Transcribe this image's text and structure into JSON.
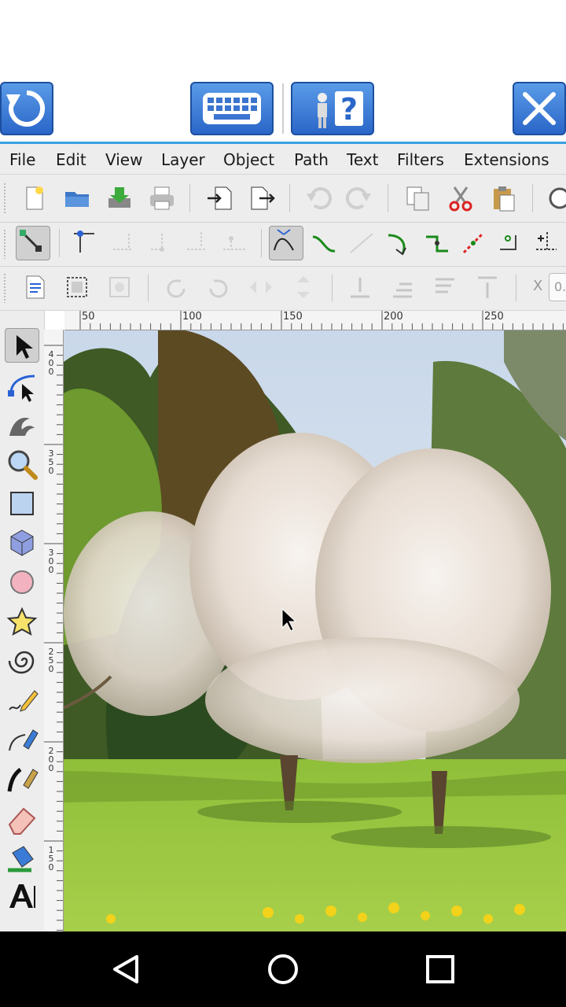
{
  "menubar": {
    "items": [
      "File",
      "Edit",
      "View",
      "Layer",
      "Object",
      "Path",
      "Text",
      "Filters",
      "Extensions"
    ]
  },
  "rulers": {
    "horizontal": [
      "50",
      "100",
      "150",
      "200",
      "250"
    ],
    "vertical": [
      "400",
      "350",
      "300",
      "250",
      "200",
      "150"
    ]
  },
  "toolbar3": {
    "x_label": "X",
    "x_value": "0."
  },
  "canvas": {
    "image_description": "blossoming tree in a park"
  },
  "colors": {
    "accent": "#3aa0e0",
    "remote_button": "#2a66c8",
    "chrome": "#ededed"
  }
}
